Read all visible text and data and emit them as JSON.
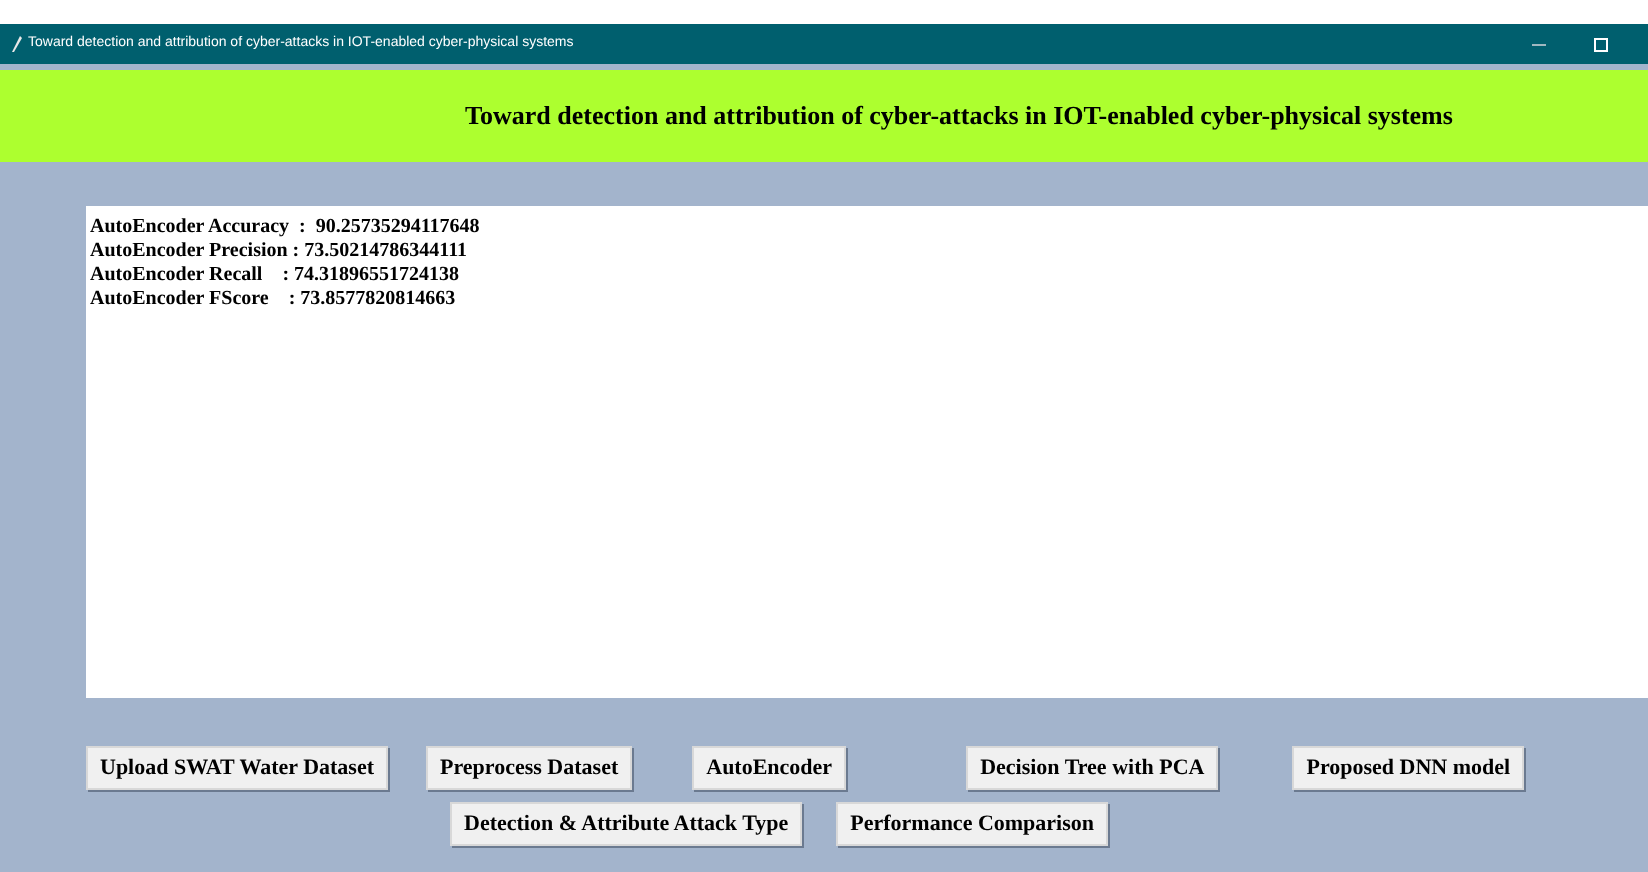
{
  "window": {
    "title": "Toward detection and attribution of cyber-attacks in IOT-enabled cyber-physical systems"
  },
  "banner": {
    "title": "Toward detection and attribution of cyber-attacks in IOT-enabled cyber-physical systems"
  },
  "output": {
    "lines": [
      "AutoEncoder Accuracy  :  90.25735294117648",
      "AutoEncoder Precision : 73.50214786344111",
      "AutoEncoder Recall    : 74.31896551724138",
      "AutoEncoder FScore    : 73.8577820814663"
    ]
  },
  "buttons_row_1": [
    "Upload SWAT Water Dataset",
    "Preprocess Dataset",
    "AutoEncoder",
    "Decision Tree with PCA",
    "Proposed DNN model"
  ],
  "buttons_row_2": [
    "Detection & Attribute Attack Type",
    "Performance Comparison"
  ]
}
